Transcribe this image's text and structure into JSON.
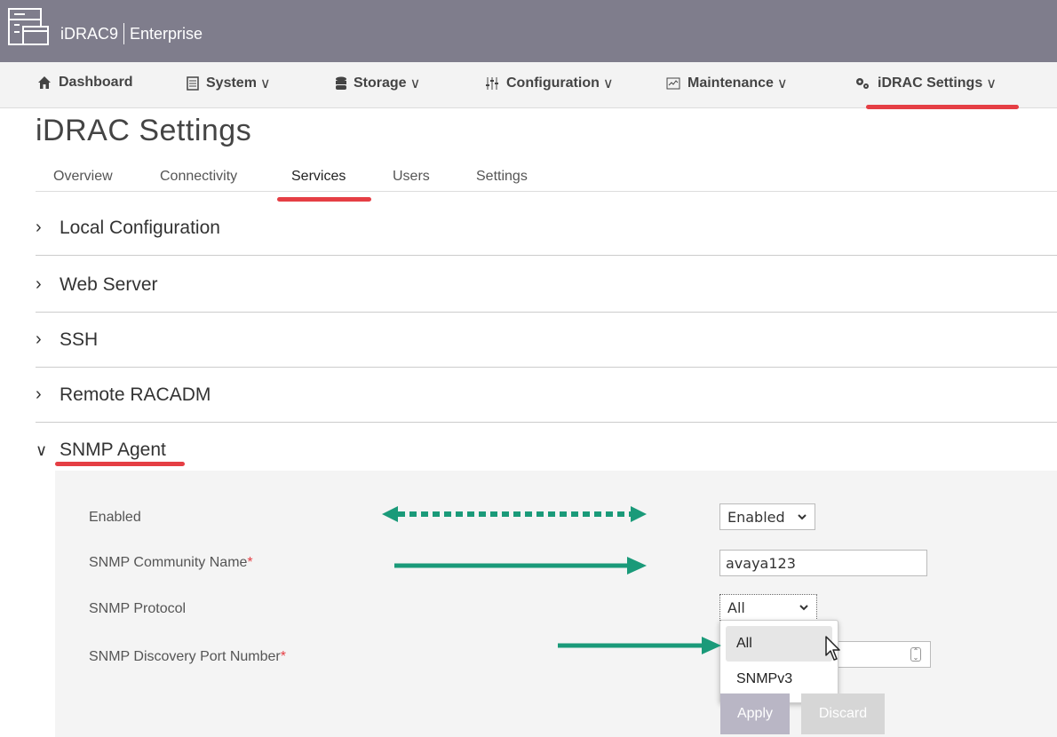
{
  "app": {
    "product": "iDRAC9",
    "edition": "Enterprise"
  },
  "nav": {
    "dashboard": "Dashboard",
    "system": "System",
    "storage": "Storage",
    "configuration": "Configuration",
    "maintenance": "Maintenance",
    "idrac_settings": "iDRAC Settings",
    "chevron": "∨"
  },
  "page": {
    "title": "iDRAC Settings"
  },
  "tabs": {
    "overview": "Overview",
    "connectivity": "Connectivity",
    "services": "Services",
    "users": "Users",
    "settings": "Settings"
  },
  "sections": {
    "local_configuration": "Local Configuration",
    "web_server": "Web Server",
    "ssh": "SSH",
    "remote_racadm": "Remote RACADM",
    "snmp_agent": "SNMP Agent"
  },
  "snmp": {
    "enabled_label": "Enabled",
    "enabled_value": "Enabled",
    "community_label": "SNMP Community Name",
    "community_value": "avaya123",
    "protocol_label": "SNMP Protocol",
    "protocol_value": "All",
    "port_label": "SNMP Discovery Port Number",
    "required_mark": "*",
    "protocol_options": [
      "All",
      "SNMPv3"
    ]
  },
  "buttons": {
    "apply": "Apply",
    "discard": "Discard"
  },
  "colors": {
    "header": "#7f7d8c",
    "accent_red": "#e53e44",
    "annotation_green": "#1a9a79"
  }
}
